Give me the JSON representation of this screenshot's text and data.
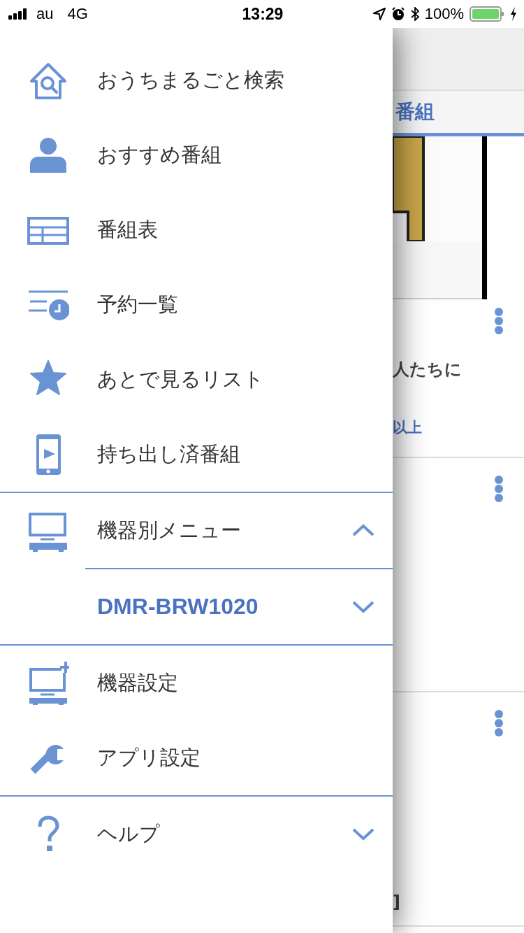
{
  "status_bar": {
    "carrier": "au",
    "network": "4G",
    "time": "13:29",
    "battery": "100%"
  },
  "background": {
    "tab_label": "番組",
    "cards": [
      {
        "kind": "thumbnail",
        "text": "人たちに",
        "link": "以上"
      },
      {
        "kind": "plain"
      },
      {
        "kind": "plain",
        "text": "]"
      }
    ]
  },
  "drawer": {
    "sections": [
      {
        "items": [
          {
            "label": "おうちまるごと検索"
          },
          {
            "label": "おすすめ番組"
          },
          {
            "label": "番組表"
          },
          {
            "label": "予約一覧"
          },
          {
            "label": "あとで見るリスト"
          },
          {
            "label": "持ち出し済番組"
          }
        ]
      },
      {
        "items": [
          {
            "label": "機器別メニュー",
            "expanded": true,
            "children": [
              {
                "label": "DMR-BRW1020",
                "expanded": false
              }
            ]
          }
        ]
      },
      {
        "items": [
          {
            "label": "機器設定"
          },
          {
            "label": "アプリ設定"
          }
        ]
      },
      {
        "items": [
          {
            "label": "ヘルプ",
            "expanded": false
          }
        ]
      }
    ]
  }
}
